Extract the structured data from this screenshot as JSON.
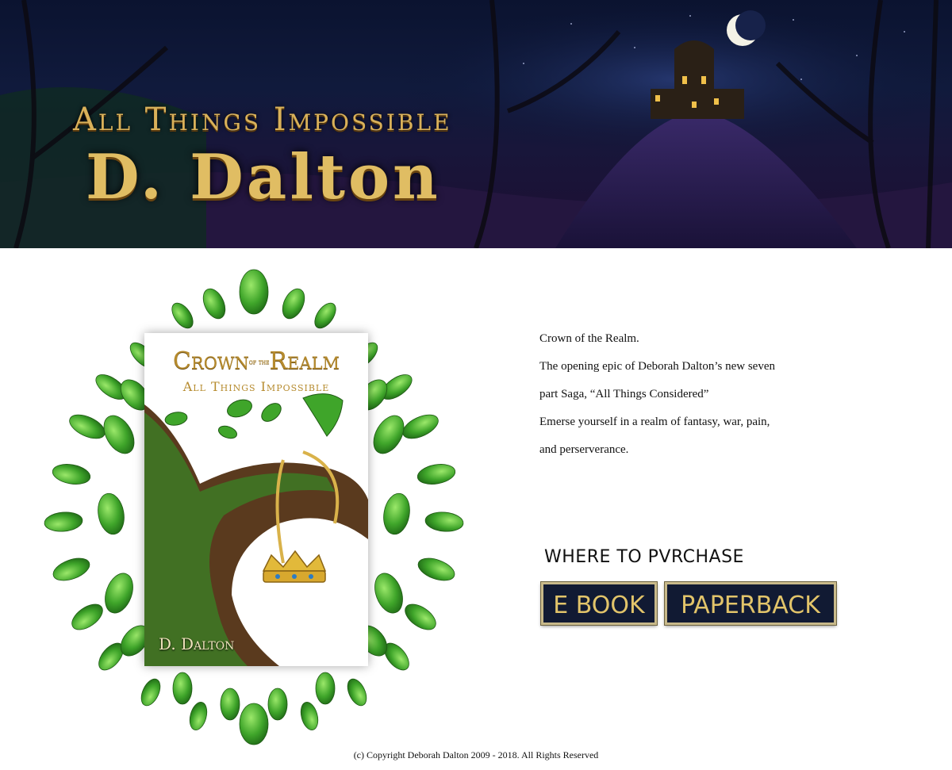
{
  "banner": {
    "series_title": "All Things Impossible",
    "author": "D. Dalton"
  },
  "book": {
    "title_part1": "Crown",
    "title_part2": "of the",
    "title_part3": "Realm",
    "subtitle": "All Things Impossible",
    "author": "D. Dalton"
  },
  "description": {
    "line1": "Crown of the Realm.",
    "line2": "The opening epic of Deborah Dalton’s new seven",
    "line3": "part Saga, “All Things Considered”",
    "line4": "Emerse yourself in a realm of fantasy, war, pain,",
    "line5": "and perserverance."
  },
  "purchase": {
    "heading": "WHERE TO PVRCHASE",
    "ebook_label": "E BOOK",
    "paperback_label": "PAPERBACK"
  },
  "footer": {
    "copyright": "(c) Copyright Deborah Dalton 2009 - 2018. All Rights Reserved"
  },
  "colors": {
    "gold": "#d9b15a",
    "button_bg": "#111a33",
    "leaf_green": "#3fa52a"
  }
}
